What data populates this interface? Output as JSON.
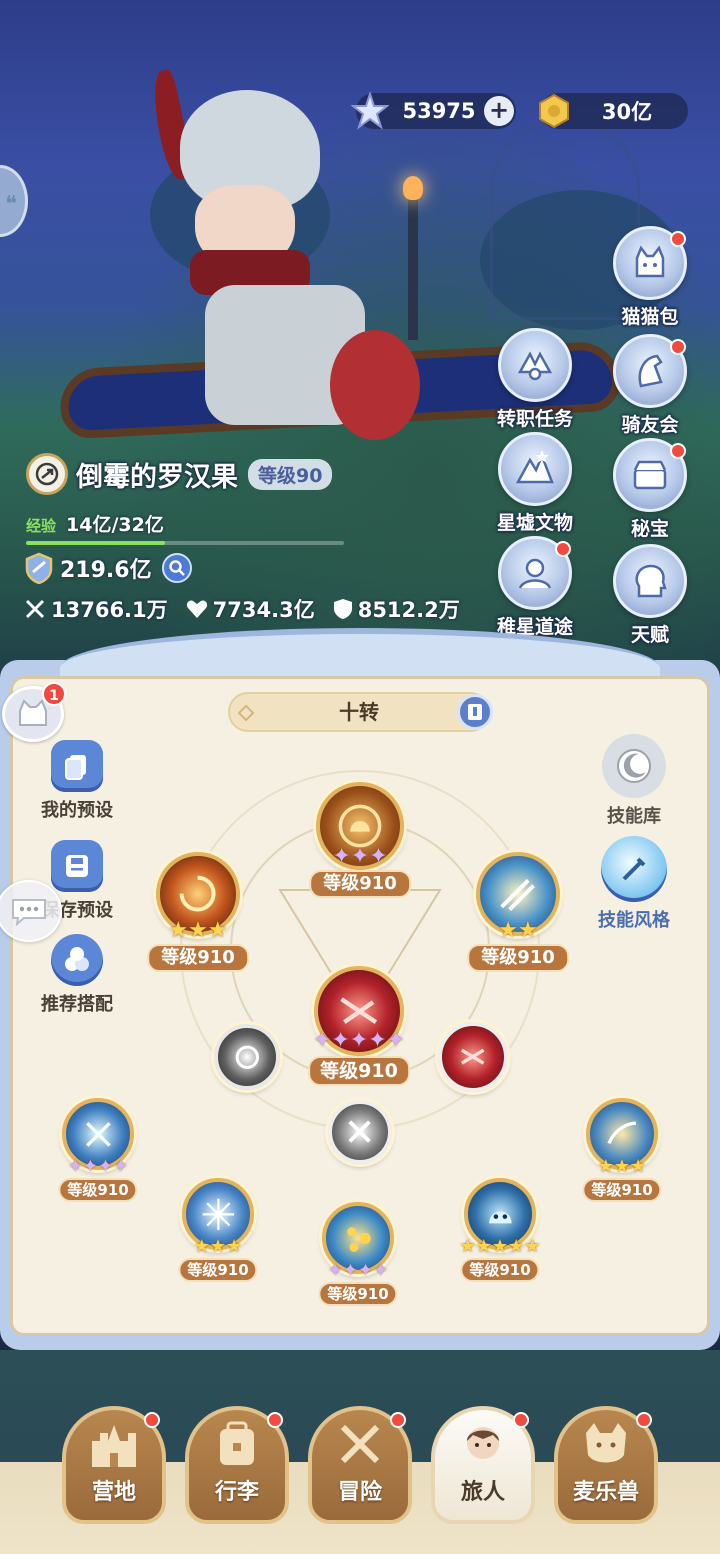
{
  "currency": {
    "stars": "53975",
    "coins": "30亿"
  },
  "player": {
    "name": "倒霉的罗汉果",
    "level": "等级90",
    "exp_label": "经验",
    "exp_value": "14亿/32亿",
    "exp_fraction": 0.4375,
    "power": "219.6亿",
    "attack": "13766.1万",
    "hp": "7734.3亿",
    "defense": "8512.2万"
  },
  "side_menu": [
    {
      "label": "猫猫包",
      "icon": "cat-bag-icon",
      "badge": true
    },
    {
      "label": "转职任务",
      "icon": "job-change-icon",
      "badge": false
    },
    {
      "label": "骑友会",
      "icon": "horse-icon",
      "badge": true
    },
    {
      "label": "星墟文物",
      "icon": "relic-icon",
      "badge": false
    },
    {
      "label": "秘宝",
      "icon": "treasure-icon",
      "badge": true
    },
    {
      "label": "稚星道途",
      "icon": "path-icon",
      "badge": true
    },
    {
      "label": "天赋",
      "icon": "talent-icon",
      "badge": false
    }
  ],
  "skill_panel": {
    "tier": "十转",
    "chat_badge": "1",
    "left_tools": [
      "我的预设",
      "保存预设",
      "推荐搭配"
    ],
    "right_tools": [
      "技能库",
      "技能风格"
    ],
    "skills": [
      {
        "id": "top",
        "level": "等级910",
        "stars": 3,
        "star_color": "purple"
      },
      {
        "id": "upper-left",
        "level": "等级910",
        "stars": 3,
        "star_color": "gold"
      },
      {
        "id": "upper-right",
        "level": "等级910",
        "stars": 2,
        "star_color": "gold"
      },
      {
        "id": "center",
        "level": "等级910",
        "stars": 5,
        "star_color": "purple"
      },
      {
        "id": "far-left",
        "level": "等级910",
        "stars": 4,
        "star_color": "purple"
      },
      {
        "id": "far-right",
        "level": "等级910",
        "stars": 3,
        "star_color": "gold"
      },
      {
        "id": "lower-left",
        "level": "等级910",
        "stars": 3,
        "star_color": "gold"
      },
      {
        "id": "lower-center",
        "level": "等级910",
        "stars": 4,
        "star_color": "purple"
      },
      {
        "id": "lower-right",
        "level": "等级910",
        "stars": 5,
        "star_color": "gold"
      }
    ]
  },
  "bottom_nav": [
    {
      "label": "营地",
      "icon": "castle-icon",
      "badge": true,
      "active": false
    },
    {
      "label": "行李",
      "icon": "backpack-icon",
      "badge": true,
      "active": false
    },
    {
      "label": "冒险",
      "icon": "crossed-swords-icon",
      "badge": true,
      "active": false
    },
    {
      "label": "旅人",
      "icon": "traveler-avatar-icon",
      "badge": true,
      "active": true
    },
    {
      "label": "麦乐兽",
      "icon": "pet-cat-icon",
      "badge": true,
      "active": false
    }
  ],
  "colors": {
    "accent_blue": "#5c86d6",
    "badge_red": "#ef4b3f",
    "level_pill": "#b8763e",
    "exp_green": "#8be05d"
  }
}
